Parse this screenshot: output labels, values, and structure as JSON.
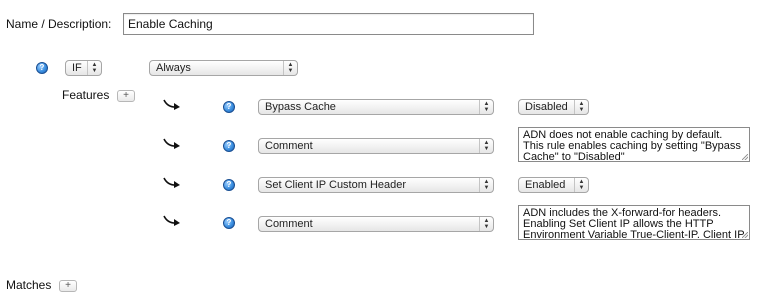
{
  "name_description": {
    "label": "Name / Description:",
    "value": "Enable Caching"
  },
  "condition": {
    "operator": "IF",
    "match": "Always"
  },
  "features": {
    "label": "Features",
    "add_symbol": "+",
    "rows": [
      {
        "feature": "Bypass Cache",
        "value_type": "select",
        "value": "Disabled"
      },
      {
        "feature": "Comment",
        "value_type": "textarea",
        "value": "ADN does not enable caching by default. This rule enables caching by setting \"Bypass Cache\" to \"Disabled\""
      },
      {
        "feature": "Set Client IP Custom Header",
        "value_type": "select",
        "value": "Enabled"
      },
      {
        "feature": "Comment",
        "value_type": "textarea",
        "value": "ADN includes the X-forward-for headers. Enabling Set Client IP allows the HTTP Environment Variable True-Client-IP. Client IP"
      }
    ]
  },
  "matches": {
    "label": "Matches",
    "add_symbol": "+"
  },
  "icons": {
    "help": "help-icon",
    "feature_arrow": "curved-arrow-icon",
    "select_arrows": "up-down-arrows-icon"
  },
  "colors": {
    "help_icon": "#3b8fe0"
  }
}
